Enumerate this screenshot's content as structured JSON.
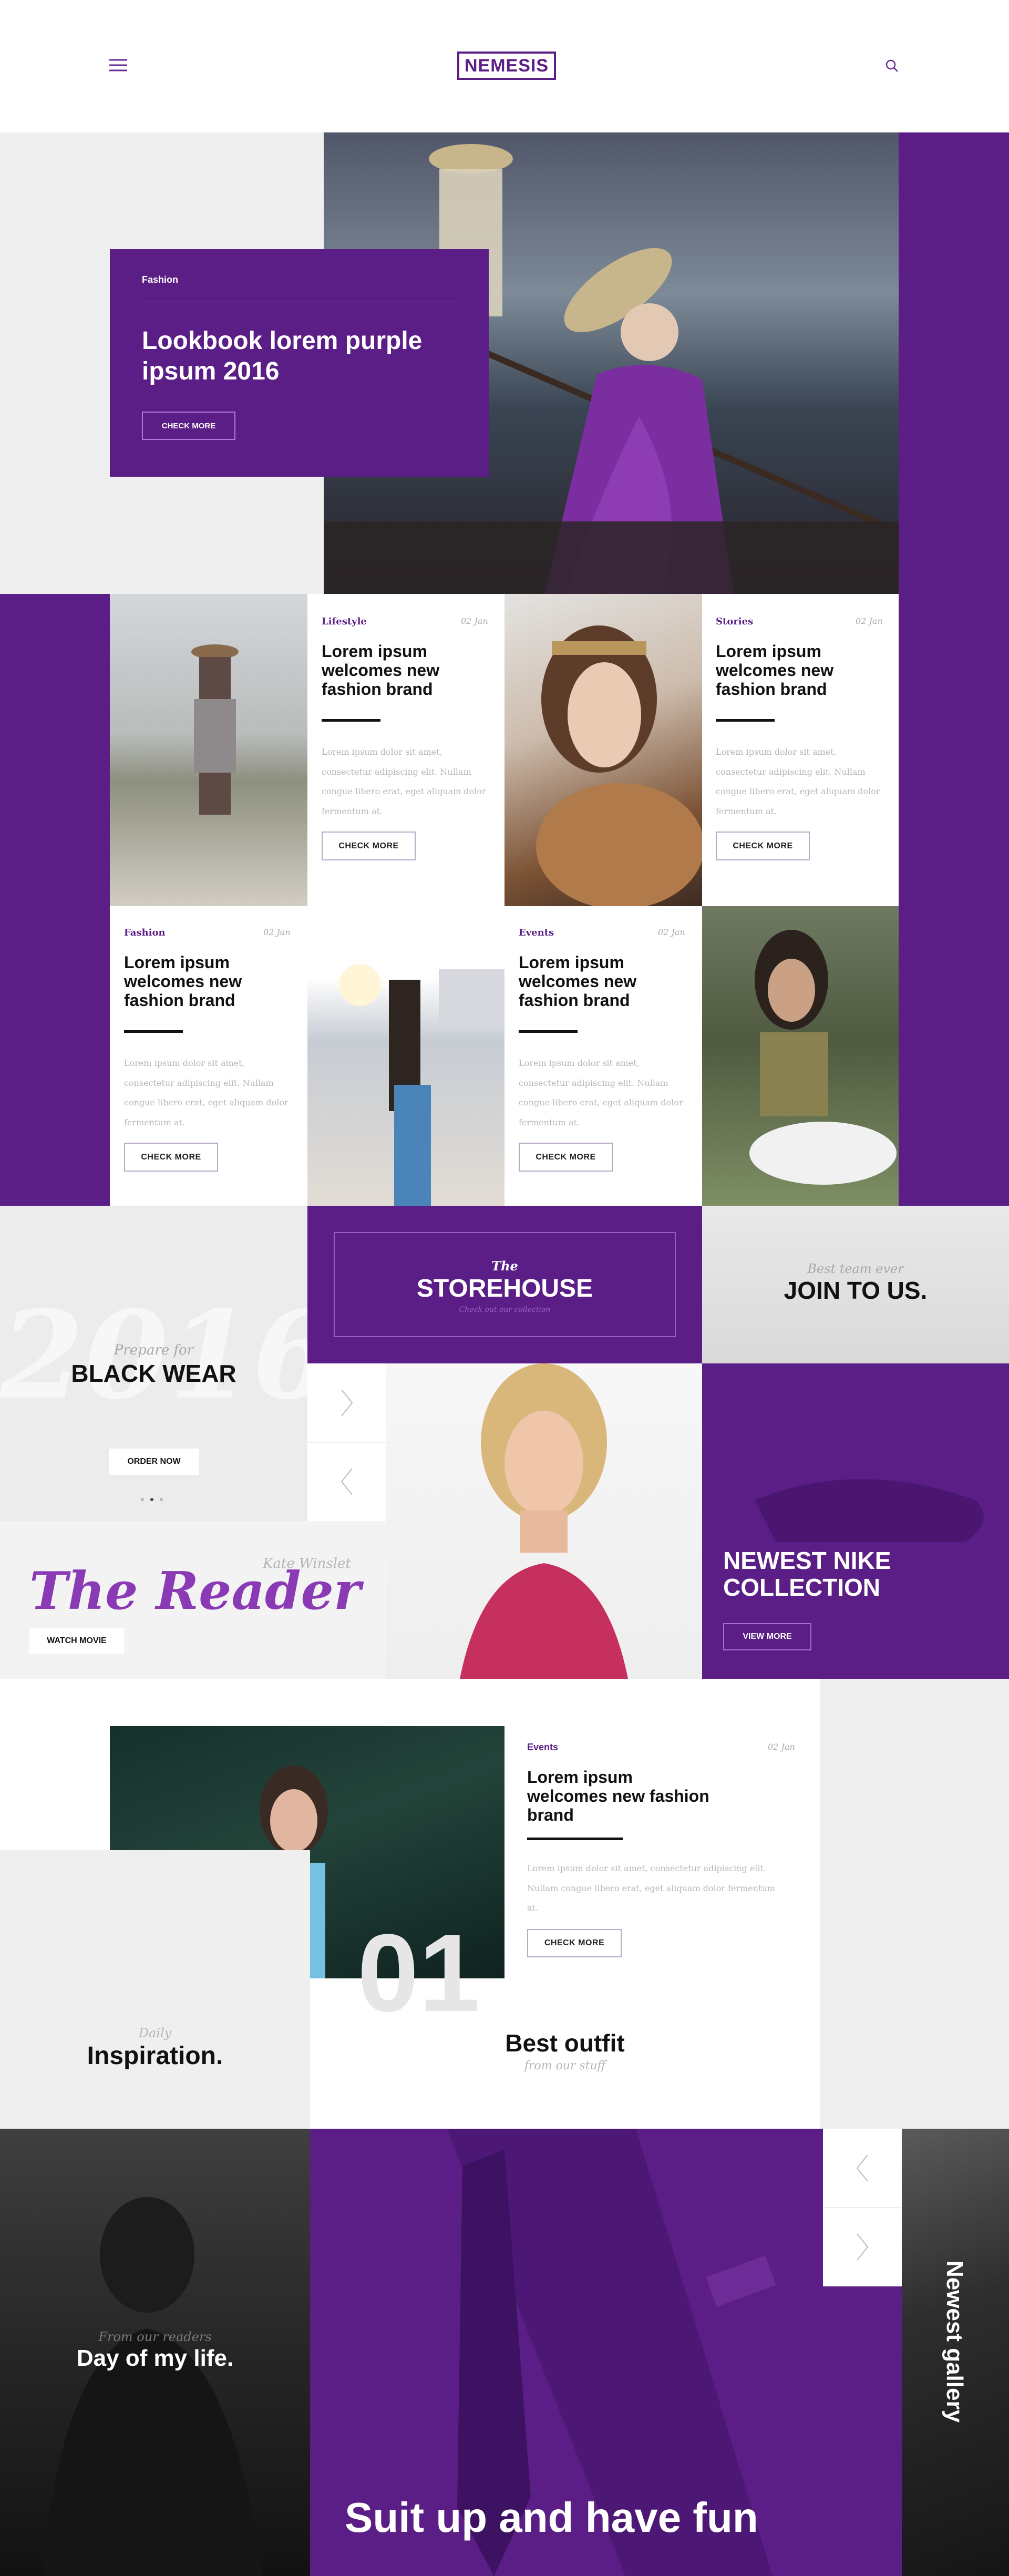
{
  "header": {
    "logo": "NEMESIS",
    "menu_icon": "hamburger-menu-icon",
    "search_icon": "search-icon"
  },
  "hero": {
    "category": "Fashion",
    "title": "Lookbook lorem purple ipsum 2016",
    "button": "CHECK MORE"
  },
  "grid": {
    "cards": [
      {
        "tag": "Lifestyle",
        "date": "02 Jan",
        "title": "Lorem ipsum welcomes new fashion brand",
        "text": "Lorem ipsum dolor sit amet, consectetur adipiscing elit. Nullam congue libero erat, eget aliquam dolor fermentum at.",
        "button": "CHECK MORE"
      },
      {
        "tag": "Stories",
        "date": "02 Jan",
        "title": "Lorem ipsum welcomes new fashion brand",
        "text": "Lorem ipsum dolor sit amet, consectetur adipiscing elit. Nullam congue libero erat, eget aliquam dolor fermentum at.",
        "button": "CHECK MORE"
      },
      {
        "tag": "Fashion",
        "date": "02 Jan",
        "title": "Lorem ipsum welcomes new fashion brand",
        "text": "Lorem ipsum dolor sit amet, consectetur adipiscing elit. Nullam congue libero erat, eget aliquam dolor fermentum at.",
        "button": "CHECK MORE"
      },
      {
        "tag": "Events",
        "date": "02 Jan",
        "title": "Lorem ipsum welcomes new fashion brand",
        "text": "Lorem ipsum dolor sit amet, consectetur adipiscing elit. Nullam congue libero erat, eget aliquam dolor fermentum at.",
        "button": "CHECK MORE"
      }
    ]
  },
  "promo": {
    "blackwear_kicker": "Prepare for",
    "blackwear_title": "BLACK WEAR",
    "blackwear_button": "ORDER NOW",
    "bg_year": "2016",
    "storehouse_kicker": "The",
    "storehouse_title": "STOREHOUSE",
    "storehouse_sub": "Check out our collection",
    "join_kicker": "Best team ever",
    "join_title": "JOIN TO US.",
    "reader_kicker": "Kate Winslet",
    "reader_title": "The Reader",
    "reader_button": "WATCH MOVIE",
    "nike_title": "NEWEST NIKE COLLECTION",
    "nike_button": "VIEW MORE"
  },
  "feature": {
    "tag": "Events",
    "date": "02 Jan",
    "title": "Lorem ipsum welcomes new fashion brand",
    "text": "Lorem ipsum dolor sit amet, consectetur adipiscing elit. Nullam congue libero erat, eget aliquam dolor fermentum at.",
    "button": "CHECK MORE",
    "number": "01",
    "inspiration_kicker": "Daily",
    "inspiration_title": "Inspiration.",
    "outfit_title": "Best outfit",
    "outfit_sub": "from our stuff"
  },
  "bottom": {
    "day_kicker": "From our readers",
    "day_title": "Day of my life.",
    "suit_title": "Suit up and have fun",
    "gallery_title": "Newest gallery"
  }
}
